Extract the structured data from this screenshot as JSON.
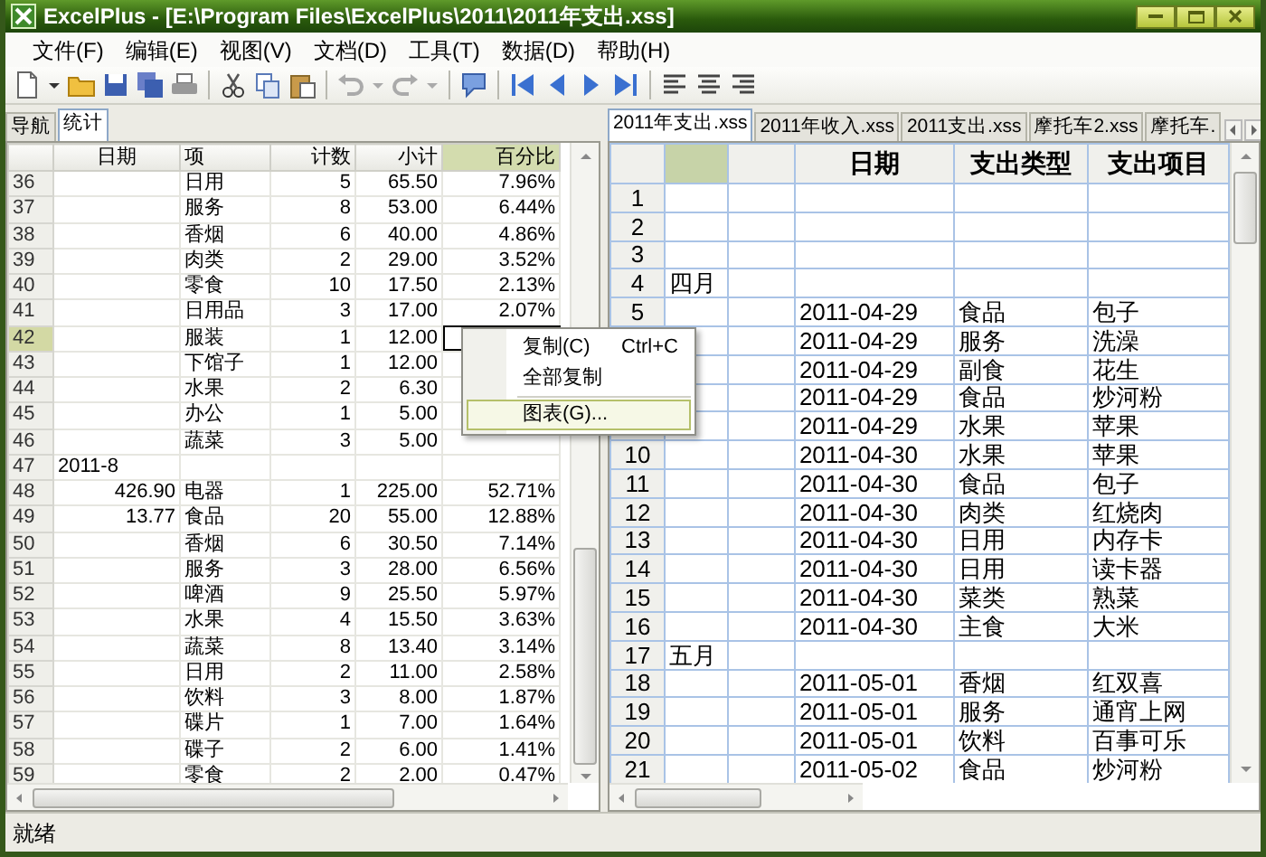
{
  "window": {
    "title": "ExcelPlus - [E:\\Program Files\\ExcelPlus\\2011\\2011年支出.xss]"
  },
  "menu": [
    "文件(F)",
    "编辑(E)",
    "视图(V)",
    "文档(D)",
    "工具(T)",
    "数据(D)",
    "帮助(H)"
  ],
  "left_panel": {
    "tabs": [
      {
        "label": "导航",
        "selected": false
      },
      {
        "label": "统计",
        "selected": true
      }
    ],
    "table": {
      "columns": [
        {
          "header": "日期",
          "selected": false
        },
        {
          "header": "项",
          "selected": false
        },
        {
          "header": "计数",
          "selected": false
        },
        {
          "header": "小计",
          "selected": false
        },
        {
          "header": "百分比",
          "selected": true
        }
      ],
      "rows": [
        {
          "num": "36",
          "kind": "item",
          "selected": false,
          "item": "日用",
          "count": "5",
          "subtotal": "65.50",
          "percent": "7.96%"
        },
        {
          "num": "37",
          "kind": "item",
          "selected": false,
          "item": "服务",
          "count": "8",
          "subtotal": "53.00",
          "percent": "6.44%"
        },
        {
          "num": "38",
          "kind": "item",
          "selected": false,
          "item": "香烟",
          "count": "6",
          "subtotal": "40.00",
          "percent": "4.86%"
        },
        {
          "num": "39",
          "kind": "item",
          "selected": false,
          "item": "肉类",
          "count": "2",
          "subtotal": "29.00",
          "percent": "3.52%"
        },
        {
          "num": "40",
          "kind": "item",
          "selected": false,
          "item": "零食",
          "count": "10",
          "subtotal": "17.50",
          "percent": "2.13%"
        },
        {
          "num": "41",
          "kind": "item",
          "selected": false,
          "item": "日用品",
          "count": "3",
          "subtotal": "17.00",
          "percent": "2.07%"
        },
        {
          "num": "42",
          "kind": "item",
          "selected": true,
          "item": "服装",
          "count": "1",
          "subtotal": "12.00"
        },
        {
          "num": "43",
          "kind": "item",
          "selected": false,
          "item": "下馆子",
          "count": "1",
          "subtotal": "12.00"
        },
        {
          "num": "44",
          "kind": "item",
          "selected": false,
          "item": "水果",
          "count": "2",
          "subtotal": "6.30"
        },
        {
          "num": "45",
          "kind": "item",
          "selected": false,
          "item": "办公",
          "count": "1",
          "subtotal": "5.00"
        },
        {
          "num": "46",
          "kind": "item",
          "selected": false,
          "item": "蔬菜",
          "count": "3",
          "subtotal": "5.00"
        },
        {
          "num": "47",
          "kind": "group",
          "selected": false,
          "date": "2011-8"
        },
        {
          "num": "48",
          "kind": "item",
          "selected": false,
          "date": "426.90",
          "item": "电器",
          "count": "1",
          "subtotal": "225.00",
          "percent": "52.71%"
        },
        {
          "num": "49",
          "kind": "item",
          "selected": false,
          "date": "13.77",
          "item": "食品",
          "count": "20",
          "subtotal": "55.00",
          "percent": "12.88%"
        },
        {
          "num": "50",
          "kind": "item",
          "selected": false,
          "item": "香烟",
          "count": "6",
          "subtotal": "30.50",
          "percent": "7.14%"
        },
        {
          "num": "51",
          "kind": "item",
          "selected": false,
          "item": "服务",
          "count": "3",
          "subtotal": "28.00",
          "percent": "6.56%"
        },
        {
          "num": "52",
          "kind": "item",
          "selected": false,
          "item": "啤酒",
          "count": "9",
          "subtotal": "25.50",
          "percent": "5.97%"
        },
        {
          "num": "53",
          "kind": "item",
          "selected": false,
          "item": "水果",
          "count": "4",
          "subtotal": "15.50",
          "percent": "3.63%"
        },
        {
          "num": "54",
          "kind": "item",
          "selected": false,
          "item": "蔬菜",
          "count": "8",
          "subtotal": "13.40",
          "percent": "3.14%"
        },
        {
          "num": "55",
          "kind": "item",
          "selected": false,
          "item": "日用",
          "count": "2",
          "subtotal": "11.00",
          "percent": "2.58%"
        },
        {
          "num": "56",
          "kind": "item",
          "selected": false,
          "item": "饮料",
          "count": "3",
          "subtotal": "8.00",
          "percent": "1.87%"
        },
        {
          "num": "57",
          "kind": "item",
          "selected": false,
          "item": "碟片",
          "count": "1",
          "subtotal": "7.00",
          "percent": "1.64%"
        },
        {
          "num": "58",
          "kind": "item",
          "selected": false,
          "item": "碟子",
          "count": "2",
          "subtotal": "6.00",
          "percent": "1.41%"
        },
        {
          "num": "59",
          "kind": "item",
          "selected": false,
          "item": "零食",
          "count": "2",
          "subtotal": "2.00",
          "percent": "0.47%"
        }
      ]
    }
  },
  "context_menu": [
    {
      "kind": "item",
      "label": "复制(C)",
      "shortcut": "Ctrl+C",
      "highlighted": false
    },
    {
      "kind": "item",
      "label": "全部复制",
      "highlighted": false
    },
    {
      "kind": "separator"
    },
    {
      "kind": "item",
      "label": "图表(G)...",
      "highlighted": true
    }
  ],
  "right_panel": {
    "tabs": [
      {
        "label": "2011年支出.xss",
        "selected": true
      },
      {
        "label": "2011年收入.xss",
        "selected": false
      },
      {
        "label": "2011支出.xss",
        "selected": false
      },
      {
        "label": "摩托车2.xss",
        "selected": false
      },
      {
        "label": "摩托车.",
        "selected": false
      }
    ],
    "table": {
      "columns": [
        {
          "selected": true
        },
        {
          "selected": false
        },
        {
          "header": "日期",
          "selected": false
        },
        {
          "header": "支出类型",
          "selected": false
        },
        {
          "header": "支出项目",
          "selected": false
        }
      ],
      "rows": [
        {
          "num": "1"
        },
        {
          "num": "2"
        },
        {
          "num": "3"
        },
        {
          "num": "4",
          "column_a": "四月"
        },
        {
          "num": "5",
          "date": "2011-04-29",
          "type": "食品",
          "item": "包子"
        },
        {
          "date": "2011-04-29",
          "type": "服务",
          "item": "洗澡"
        },
        {
          "date": "2011-04-29",
          "type": "副食",
          "item": "花生"
        },
        {
          "date": "2011-04-29",
          "type": "食品",
          "item": "炒河粉"
        },
        {
          "date": "2011-04-29",
          "type": "水果",
          "item": "苹果"
        },
        {
          "num": "10",
          "date": "2011-04-30",
          "type": "水果",
          "item": "苹果"
        },
        {
          "num": "11",
          "date": "2011-04-30",
          "type": "食品",
          "item": "包子"
        },
        {
          "num": "12",
          "date": "2011-04-30",
          "type": "肉类",
          "item": "红烧肉"
        },
        {
          "num": "13",
          "date": "2011-04-30",
          "type": "日用",
          "item": "内存卡"
        },
        {
          "num": "14",
          "date": "2011-04-30",
          "type": "日用",
          "item": "读卡器"
        },
        {
          "num": "15",
          "date": "2011-04-30",
          "type": "菜类",
          "item": "熟菜"
        },
        {
          "num": "16",
          "date": "2011-04-30",
          "type": "主食",
          "item": "大米"
        },
        {
          "num": "17",
          "column_a": "五月"
        },
        {
          "num": "18",
          "date": "2011-05-01",
          "type": "香烟",
          "item": "红双喜"
        },
        {
          "num": "19",
          "date": "2011-05-01",
          "type": "服务",
          "item": "通宵上网"
        },
        {
          "num": "20",
          "date": "2011-05-01",
          "type": "饮料",
          "item": "百事可乐"
        },
        {
          "num": "21",
          "date": "2011-05-02",
          "type": "食品",
          "item": "炒河粉"
        }
      ]
    }
  },
  "status_bar": {
    "text": "就绪"
  }
}
